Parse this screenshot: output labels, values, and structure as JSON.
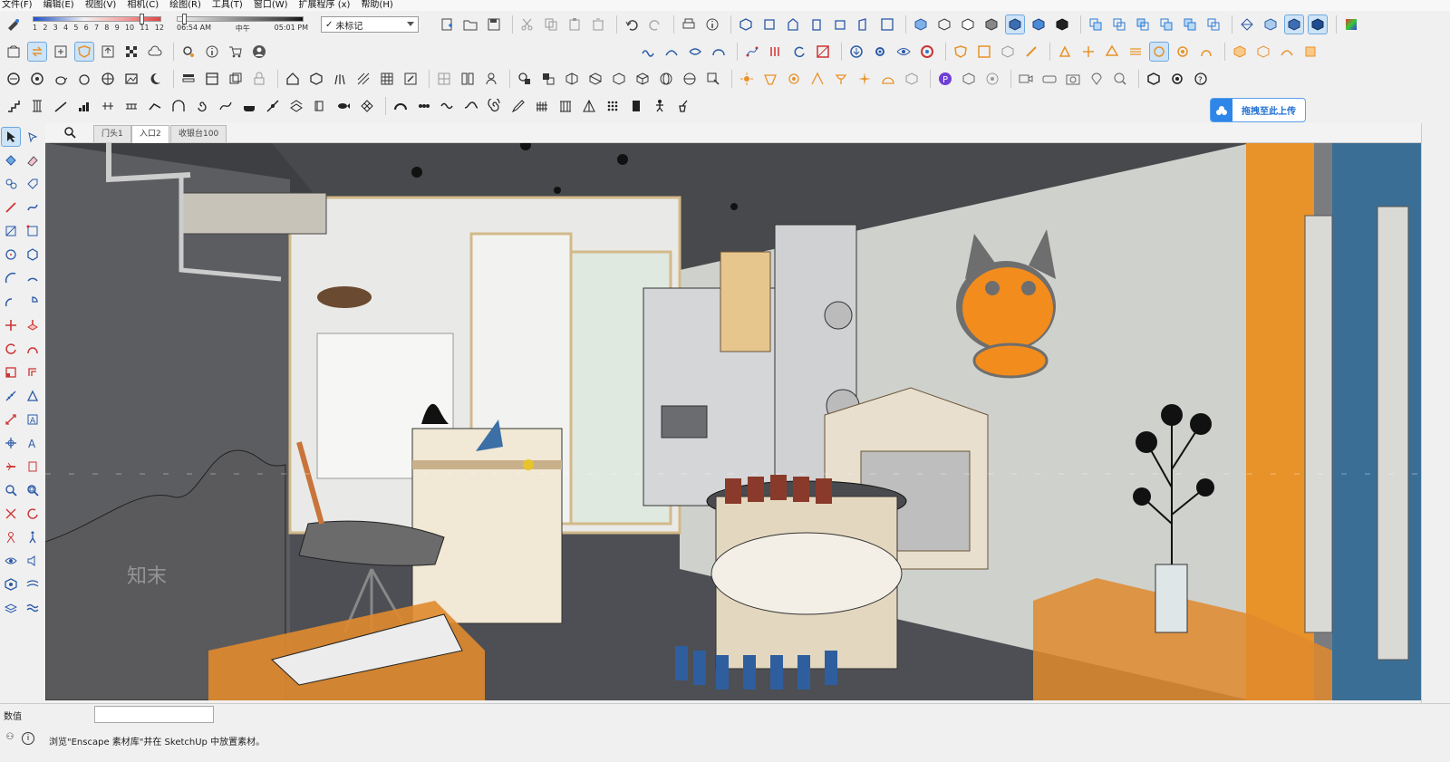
{
  "menubar": {
    "items": [
      "文件(F)",
      "编辑(E)",
      "视图(V)",
      "相机(C)",
      "绘图(R)",
      "工具(T)",
      "窗口(W)",
      "扩展程序 (x)",
      "帮助(H)"
    ]
  },
  "shadow": {
    "months": [
      "1",
      "2",
      "3",
      "4",
      "5",
      "6",
      "7",
      "8",
      "9",
      "10",
      "11",
      "12"
    ],
    "times": [
      "06:54 AM",
      "中午",
      "05:01 PM"
    ]
  },
  "scene": {
    "selected": "未标记"
  },
  "upload": {
    "label": "拖拽至此上传"
  },
  "tabs": [
    "门头1",
    "入口2",
    "收银台100"
  ],
  "active_tab": "入口2",
  "measurements": {
    "label": "数值",
    "value": ""
  },
  "status": {
    "message": "浏览\"Enscape 素材库\"并在 SketchUp 中放置素材。"
  },
  "watermark": {
    "text": "知末"
  },
  "colors": {
    "accent_blue": "#2d86e8",
    "orange_wall": "#e8922a",
    "cat_orange": "#f28c1d"
  }
}
